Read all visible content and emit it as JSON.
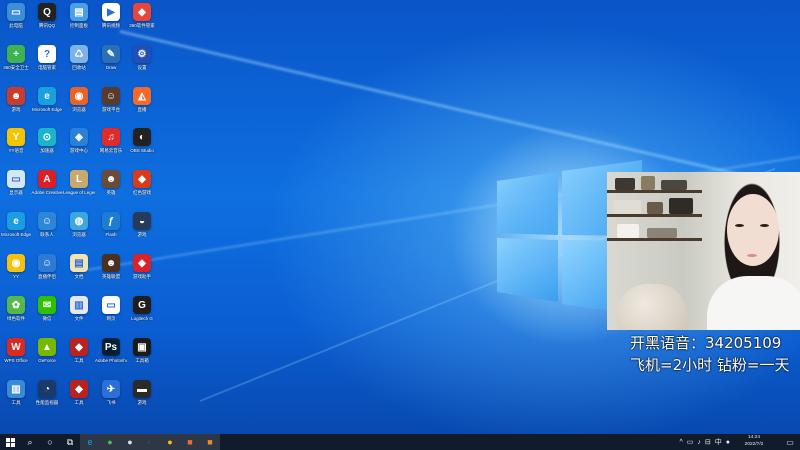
{
  "colors": {
    "desktop_bg": "#0e6fe0",
    "taskbar_bg": "#101c2c"
  },
  "desktop_icons": [
    {
      "name": "this-pc",
      "label": "此电脑",
      "color": "#3b8fd9",
      "glyph": "▭",
      "col": 0,
      "row": 0
    },
    {
      "name": "qq",
      "label": "腾讯QQ",
      "color": "#222222",
      "glyph": "Q",
      "col": 1,
      "row": 0
    },
    {
      "name": "control-panel",
      "label": "控制面板",
      "color": "#4aa0e6",
      "glyph": "▤",
      "col": 2,
      "row": 0
    },
    {
      "name": "tencent-video",
      "label": "腾讯视频",
      "color": "#ffffff",
      "glyph": "▶",
      "col": 3,
      "row": 0
    },
    {
      "name": "app-grid",
      "label": "360软件管家",
      "color": "#e8453c",
      "glyph": "◆",
      "col": 4,
      "row": 0
    },
    {
      "name": "security-guard",
      "label": "360安全卫士",
      "color": "#3fb34f",
      "glyph": "+",
      "col": 0,
      "row": 1
    },
    {
      "name": "help",
      "label": "电脑管家",
      "color": "#ffffff",
      "glyph": "?",
      "col": 1,
      "row": 1
    },
    {
      "name": "recycle-bin",
      "label": "回收站",
      "color": "#7db3e8",
      "glyph": "♺",
      "col": 2,
      "row": 1
    },
    {
      "name": "pen-tool",
      "label": "Draw",
      "color": "#2a6fb8",
      "glyph": "✎",
      "col": 3,
      "row": 1
    },
    {
      "name": "app-settings",
      "label": "设置",
      "color": "#1f4fb8",
      "glyph": "⚙",
      "col": 4,
      "row": 1
    },
    {
      "name": "game-char",
      "label": "游戏",
      "color": "#cc3a2a",
      "glyph": "☻",
      "col": 0,
      "row": 2
    },
    {
      "name": "edge-legacy",
      "label": "Microsoft Edge",
      "color": "#1aa0e0",
      "glyph": "e",
      "col": 1,
      "row": 2
    },
    {
      "name": "browser-orange",
      "label": "浏览器",
      "color": "#e8622a",
      "glyph": "◉",
      "col": 2,
      "row": 2
    },
    {
      "name": "game-avatar",
      "label": "游戏平台",
      "color": "#5a3a2a",
      "glyph": "☺",
      "col": 3,
      "row": 2
    },
    {
      "name": "orange-app",
      "label": "直播",
      "color": "#f26a2c",
      "glyph": "◭",
      "col": 4,
      "row": 2
    },
    {
      "name": "yy-voice",
      "label": "YY语音",
      "color": "#f5c400",
      "glyph": "Y",
      "col": 0,
      "row": 3
    },
    {
      "name": "cyan-app",
      "label": "加速器",
      "color": "#19b6c9",
      "glyph": "⊙",
      "col": 1,
      "row": 3
    },
    {
      "name": "cube-app",
      "label": "游戏中心",
      "color": "#2a7fd9",
      "glyph": "◈",
      "col": 2,
      "row": 3
    },
    {
      "name": "netease-music",
      "label": "网易云音乐",
      "color": "#e02b2b",
      "glyph": "♫",
      "col": 3,
      "row": 3
    },
    {
      "name": "obs-studio",
      "label": "OBS Studio",
      "color": "#222222",
      "glyph": "◐",
      "col": 4,
      "row": 3
    },
    {
      "name": "monitor-app",
      "label": "显示器",
      "color": "#d7e7f7",
      "glyph": "▭",
      "col": 0,
      "row": 4
    },
    {
      "name": "adobe-cc",
      "label": "Adobe Creative",
      "color": "#da1f26",
      "glyph": "A",
      "col": 1,
      "row": 4
    },
    {
      "name": "league",
      "label": "League of Legends",
      "color": "#c8aa6e",
      "glyph": "L",
      "col": 2,
      "row": 4
    },
    {
      "name": "game-portrait",
      "label": "英雄",
      "color": "#6a4a3a",
      "glyph": "☻",
      "col": 3,
      "row": 4
    },
    {
      "name": "red-game",
      "label": "红色游戏",
      "color": "#d83a1c",
      "glyph": "◆",
      "col": 4,
      "row": 4
    },
    {
      "name": "edge",
      "label": "Microsoft Edge",
      "color": "#1b9de2",
      "glyph": "e",
      "col": 0,
      "row": 5
    },
    {
      "name": "people-app",
      "label": "联系人",
      "color": "#2b88d8",
      "glyph": "☺",
      "col": 1,
      "row": 5
    },
    {
      "name": "globe-app",
      "label": "浏览器",
      "color": "#3aa7e0",
      "glyph": "◍",
      "col": 2,
      "row": 5
    },
    {
      "name": "flash",
      "label": "Flash",
      "color": "#1d7ecf",
      "glyph": "ƒ",
      "col": 3,
      "row": 5
    },
    {
      "name": "steam-app",
      "label": "游戏",
      "color": "#263a5a",
      "glyph": "◒",
      "col": 4,
      "row": 5
    },
    {
      "name": "yellow-owl",
      "label": "YY",
      "color": "#f3c10f",
      "glyph": "◉",
      "col": 0,
      "row": 6
    },
    {
      "name": "person-app",
      "label": "直播伴侣",
      "color": "#2c7bd6",
      "glyph": "☺",
      "col": 1,
      "row": 6
    },
    {
      "name": "doc-app",
      "label": "文档",
      "color": "#f4e2b0",
      "glyph": "▤",
      "col": 2,
      "row": 6
    },
    {
      "name": "hero-app",
      "label": "英雄联盟",
      "color": "#4a3020",
      "glyph": "☻",
      "col": 3,
      "row": 6
    },
    {
      "name": "red-app",
      "label": "游戏助手",
      "color": "#d8232a",
      "glyph": "◆",
      "col": 4,
      "row": 6
    },
    {
      "name": "green-app",
      "label": "绿色软件",
      "color": "#55b948",
      "glyph": "✿",
      "col": 0,
      "row": 7
    },
    {
      "name": "wechat",
      "label": "微信",
      "color": "#2dc100",
      "glyph": "✉",
      "col": 1,
      "row": 7
    },
    {
      "name": "blue-doc",
      "label": "文件",
      "color": "#e8e8e8",
      "glyph": "▥",
      "col": 2,
      "row": 7
    },
    {
      "name": "white-app",
      "label": "网页",
      "color": "#ffffff",
      "glyph": "▭",
      "col": 3,
      "row": 7
    },
    {
      "name": "logitech",
      "label": "Logitech G",
      "color": "#1e1e1e",
      "glyph": "G",
      "col": 4,
      "row": 7
    },
    {
      "name": "wps",
      "label": "WPS Office",
      "color": "#d82a20",
      "glyph": "W",
      "col": 0,
      "row": 8
    },
    {
      "name": "nvidia",
      "label": "GeForce",
      "color": "#76b900",
      "glyph": "▲",
      "col": 1,
      "row": 8
    },
    {
      "name": "red-icon",
      "label": "工具",
      "color": "#b8231f",
      "glyph": "◆",
      "col": 2,
      "row": 8
    },
    {
      "name": "photoshop",
      "label": "Adobe Photoshop",
      "color": "#001e36",
      "glyph": "Ps",
      "col": 3,
      "row": 8
    },
    {
      "name": "black-app",
      "label": "工具箱",
      "color": "#1a1a1a",
      "glyph": "▣",
      "col": 4,
      "row": 8
    },
    {
      "name": "blue-mark",
      "label": "工具",
      "color": "#3a8ad8",
      "glyph": "▥",
      "col": 0,
      "row": 9
    },
    {
      "name": "gauge-app",
      "label": "性能监视器",
      "color": "#1a3a6a",
      "glyph": "◔",
      "col": 1,
      "row": 9
    },
    {
      "name": "red-icon-2",
      "label": "工具",
      "color": "#b8231f",
      "glyph": "◆",
      "col": 2,
      "row": 9
    },
    {
      "name": "paper-plane",
      "label": "飞书",
      "color": "#2c6fd6",
      "glyph": "✈",
      "col": 3,
      "row": 9
    },
    {
      "name": "dark-app",
      "label": "游戏",
      "color": "#2a2a2a",
      "glyph": "▬",
      "col": 4,
      "row": 9
    }
  ],
  "stream_overlay": {
    "line1": "开黑语音：34205109",
    "line2": "飞机=2小时 钻粉=一天"
  },
  "taskbar": {
    "start_icon": "windows-start-icon",
    "apps": [
      {
        "name": "search",
        "glyph": "⌕",
        "color": "#ffffff"
      },
      {
        "name": "cortana",
        "glyph": "○",
        "color": "#ffffff"
      },
      {
        "name": "task-view",
        "glyph": "⧉",
        "color": "#ffffff"
      },
      {
        "name": "edge",
        "glyph": "e",
        "color": "#1b9de2"
      },
      {
        "name": "green-app",
        "glyph": "●",
        "color": "#55b948"
      },
      {
        "name": "circle-app",
        "glyph": "●",
        "color": "#dcdcdc"
      },
      {
        "name": "obs",
        "glyph": "◐",
        "color": "#444444"
      },
      {
        "name": "yy",
        "glyph": "●",
        "color": "#f5c400"
      },
      {
        "name": "orange-app",
        "glyph": "■",
        "color": "#f26a2c"
      },
      {
        "name": "orange-app-2",
        "glyph": "■",
        "color": "#f08a24"
      }
    ],
    "tray_icons": [
      "^",
      "▭",
      "♪",
      "⊟",
      "中",
      "●"
    ],
    "time": "14:24",
    "date": "2022/7/2"
  }
}
